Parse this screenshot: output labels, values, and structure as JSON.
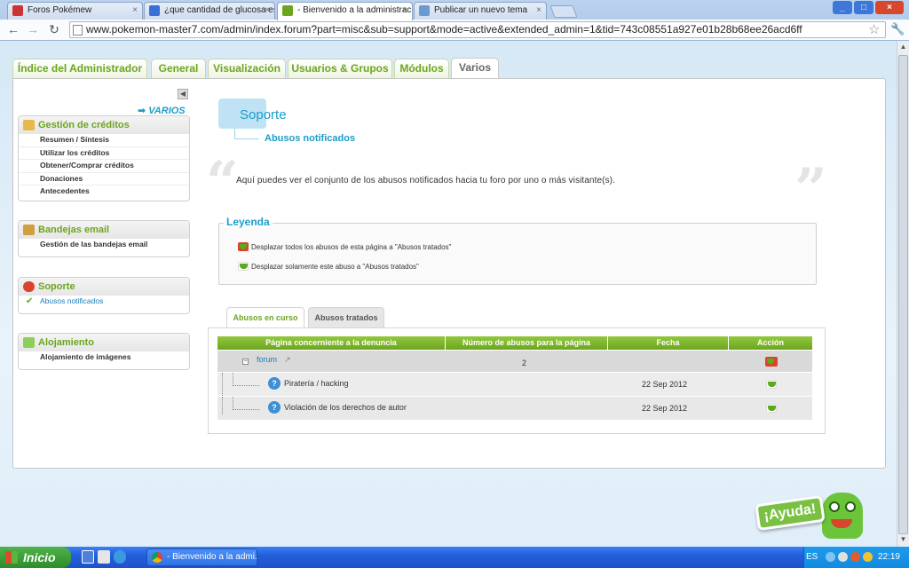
{
  "browser": {
    "tabs": [
      {
        "title": "Foros Pokémew",
        "active": false,
        "icon": "pokeball-favicon"
      },
      {
        "title": "¿que cantidad de glucosa es",
        "active": false,
        "icon": "google-favicon"
      },
      {
        "title": "- Bienvenido a la administraci",
        "active": true,
        "icon": "chat-favicon"
      },
      {
        "title": "Publicar un nuevo tema",
        "active": false,
        "icon": "puzzle-favicon"
      }
    ],
    "tab_close_glyph": "×",
    "url": "www.pokemon-master7.com/admin/index.forum?part=misc&sub=support&mode=active&extended_admin=1&tid=743c08551a927e01b28b68ee26acd6ff",
    "window_controls": [
      "_",
      "□",
      "×"
    ]
  },
  "admin_tabs": [
    {
      "label": "Índice del Administrador",
      "active": false
    },
    {
      "label": "General",
      "active": false
    },
    {
      "label": "Visualización",
      "active": false
    },
    {
      "label": "Usuarios & Grupos",
      "active": false
    },
    {
      "label": "Módulos",
      "active": false
    },
    {
      "label": "Varios",
      "active": true
    }
  ],
  "sidebar": {
    "section_title": "VARIOS",
    "boxes": [
      {
        "title": "Gestión de créditos",
        "items": [
          "Resumen / Síntesis",
          "Utilizar los créditos",
          "Obtener/Comprar créditos",
          "Donaciones",
          "Antecedentes"
        ]
      },
      {
        "title": "Bandejas email",
        "items": [
          "Gestión de las bandejas email"
        ]
      },
      {
        "title": "Soporte",
        "items": [
          "Abusos notificados"
        ],
        "selected": 0
      },
      {
        "title": "Alojamiento",
        "items": [
          "Alojamiento de imágenes"
        ]
      }
    ]
  },
  "main": {
    "title": "Soporte",
    "subtitle": "Abusos notificados",
    "description": "Aquí puedes ver el conjunto de los abusos notificados hacia tu foro por uno o más visitante(s).",
    "legend": {
      "title": "Leyenda",
      "rows": [
        "Desplazar todos los abusos de esta página a \"Abusos tratados\"",
        "Desplazar solamente este abuso a \"Abusos tratados\""
      ]
    },
    "subtabs": [
      {
        "label": "Abusos en curso",
        "active": true
      },
      {
        "label": "Abusos tratados",
        "active": false
      }
    ],
    "table": {
      "headers": [
        "Página concerniente a la denuncia",
        "Número de abusos para la página",
        "Fecha",
        "Acción"
      ],
      "group": {
        "name": "forum",
        "count": "2"
      },
      "rows": [
        {
          "reason": "Piratería / hacking",
          "date": "22 Sep 2012"
        },
        {
          "reason": "Violación de los derechos de autor",
          "date": "22 Sep 2012"
        }
      ]
    }
  },
  "help_button": "¡Ayuda!",
  "taskbar": {
    "start_label": "Inicio",
    "task_title": "- Bienvenido a la admi...",
    "language": "ES",
    "clock": "22:19"
  },
  "colors": {
    "accent_green": "#6da51e",
    "accent_blue": "#1a9fc9",
    "taskbar_blue": "#245edc"
  }
}
